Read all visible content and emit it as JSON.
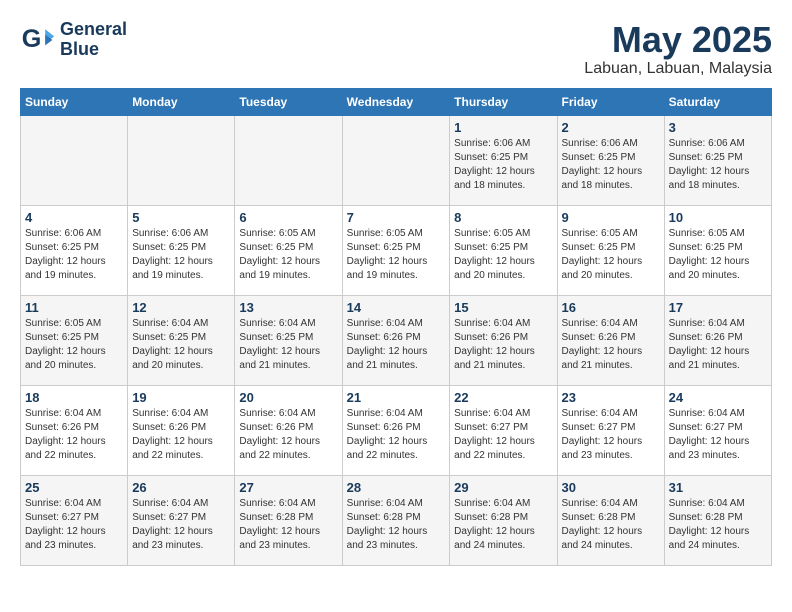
{
  "header": {
    "logo_line1": "General",
    "logo_line2": "Blue",
    "month": "May 2025",
    "location": "Labuan, Labuan, Malaysia"
  },
  "weekdays": [
    "Sunday",
    "Monday",
    "Tuesday",
    "Wednesday",
    "Thursday",
    "Friday",
    "Saturday"
  ],
  "weeks": [
    [
      {
        "day": "",
        "info": ""
      },
      {
        "day": "",
        "info": ""
      },
      {
        "day": "",
        "info": ""
      },
      {
        "day": "",
        "info": ""
      },
      {
        "day": "1",
        "info": "Sunrise: 6:06 AM\nSunset: 6:25 PM\nDaylight: 12 hours\nand 18 minutes."
      },
      {
        "day": "2",
        "info": "Sunrise: 6:06 AM\nSunset: 6:25 PM\nDaylight: 12 hours\nand 18 minutes."
      },
      {
        "day": "3",
        "info": "Sunrise: 6:06 AM\nSunset: 6:25 PM\nDaylight: 12 hours\nand 18 minutes."
      }
    ],
    [
      {
        "day": "4",
        "info": "Sunrise: 6:06 AM\nSunset: 6:25 PM\nDaylight: 12 hours\nand 19 minutes."
      },
      {
        "day": "5",
        "info": "Sunrise: 6:06 AM\nSunset: 6:25 PM\nDaylight: 12 hours\nand 19 minutes."
      },
      {
        "day": "6",
        "info": "Sunrise: 6:05 AM\nSunset: 6:25 PM\nDaylight: 12 hours\nand 19 minutes."
      },
      {
        "day": "7",
        "info": "Sunrise: 6:05 AM\nSunset: 6:25 PM\nDaylight: 12 hours\nand 19 minutes."
      },
      {
        "day": "8",
        "info": "Sunrise: 6:05 AM\nSunset: 6:25 PM\nDaylight: 12 hours\nand 20 minutes."
      },
      {
        "day": "9",
        "info": "Sunrise: 6:05 AM\nSunset: 6:25 PM\nDaylight: 12 hours\nand 20 minutes."
      },
      {
        "day": "10",
        "info": "Sunrise: 6:05 AM\nSunset: 6:25 PM\nDaylight: 12 hours\nand 20 minutes."
      }
    ],
    [
      {
        "day": "11",
        "info": "Sunrise: 6:05 AM\nSunset: 6:25 PM\nDaylight: 12 hours\nand 20 minutes."
      },
      {
        "day": "12",
        "info": "Sunrise: 6:04 AM\nSunset: 6:25 PM\nDaylight: 12 hours\nand 20 minutes."
      },
      {
        "day": "13",
        "info": "Sunrise: 6:04 AM\nSunset: 6:25 PM\nDaylight: 12 hours\nand 21 minutes."
      },
      {
        "day": "14",
        "info": "Sunrise: 6:04 AM\nSunset: 6:26 PM\nDaylight: 12 hours\nand 21 minutes."
      },
      {
        "day": "15",
        "info": "Sunrise: 6:04 AM\nSunset: 6:26 PM\nDaylight: 12 hours\nand 21 minutes."
      },
      {
        "day": "16",
        "info": "Sunrise: 6:04 AM\nSunset: 6:26 PM\nDaylight: 12 hours\nand 21 minutes."
      },
      {
        "day": "17",
        "info": "Sunrise: 6:04 AM\nSunset: 6:26 PM\nDaylight: 12 hours\nand 21 minutes."
      }
    ],
    [
      {
        "day": "18",
        "info": "Sunrise: 6:04 AM\nSunset: 6:26 PM\nDaylight: 12 hours\nand 22 minutes."
      },
      {
        "day": "19",
        "info": "Sunrise: 6:04 AM\nSunset: 6:26 PM\nDaylight: 12 hours\nand 22 minutes."
      },
      {
        "day": "20",
        "info": "Sunrise: 6:04 AM\nSunset: 6:26 PM\nDaylight: 12 hours\nand 22 minutes."
      },
      {
        "day": "21",
        "info": "Sunrise: 6:04 AM\nSunset: 6:26 PM\nDaylight: 12 hours\nand 22 minutes."
      },
      {
        "day": "22",
        "info": "Sunrise: 6:04 AM\nSunset: 6:27 PM\nDaylight: 12 hours\nand 22 minutes."
      },
      {
        "day": "23",
        "info": "Sunrise: 6:04 AM\nSunset: 6:27 PM\nDaylight: 12 hours\nand 23 minutes."
      },
      {
        "day": "24",
        "info": "Sunrise: 6:04 AM\nSunset: 6:27 PM\nDaylight: 12 hours\nand 23 minutes."
      }
    ],
    [
      {
        "day": "25",
        "info": "Sunrise: 6:04 AM\nSunset: 6:27 PM\nDaylight: 12 hours\nand 23 minutes."
      },
      {
        "day": "26",
        "info": "Sunrise: 6:04 AM\nSunset: 6:27 PM\nDaylight: 12 hours\nand 23 minutes."
      },
      {
        "day": "27",
        "info": "Sunrise: 6:04 AM\nSunset: 6:28 PM\nDaylight: 12 hours\nand 23 minutes."
      },
      {
        "day": "28",
        "info": "Sunrise: 6:04 AM\nSunset: 6:28 PM\nDaylight: 12 hours\nand 23 minutes."
      },
      {
        "day": "29",
        "info": "Sunrise: 6:04 AM\nSunset: 6:28 PM\nDaylight: 12 hours\nand 24 minutes."
      },
      {
        "day": "30",
        "info": "Sunrise: 6:04 AM\nSunset: 6:28 PM\nDaylight: 12 hours\nand 24 minutes."
      },
      {
        "day": "31",
        "info": "Sunrise: 6:04 AM\nSunset: 6:28 PM\nDaylight: 12 hours\nand 24 minutes."
      }
    ]
  ]
}
